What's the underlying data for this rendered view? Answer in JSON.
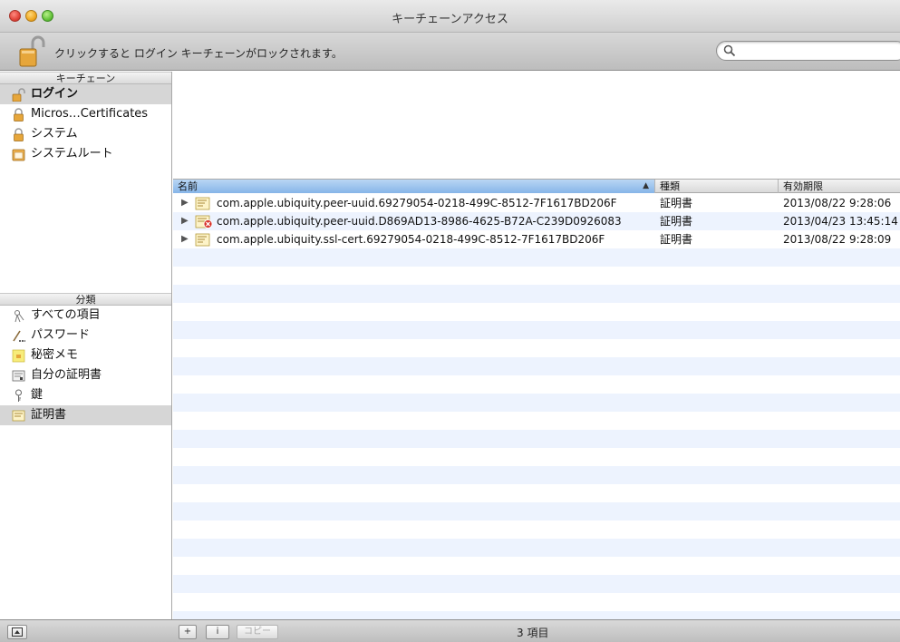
{
  "window": {
    "title": "キーチェーンアクセス"
  },
  "toolbar": {
    "lock_message": "クリックすると ログイン キーチェーンがロックされます。",
    "search_placeholder": ""
  },
  "sidebar": {
    "keychains_header": "キーチェーン",
    "keychains": [
      {
        "label": "ログイン",
        "icon": "unlocked-padlock-icon",
        "selected": true
      },
      {
        "label": "Micros…Certificates",
        "icon": "padlock-icon"
      },
      {
        "label": "システム",
        "icon": "padlock-icon"
      },
      {
        "label": "システムルート",
        "icon": "cabinet-icon"
      }
    ],
    "category_header": "分類",
    "categories": [
      {
        "label": "すべての項目",
        "icon": "all-items-icon"
      },
      {
        "label": "パスワード",
        "icon": "password-icon"
      },
      {
        "label": "秘密メモ",
        "icon": "secure-note-icon"
      },
      {
        "label": "自分の証明書",
        "icon": "my-certificate-icon"
      },
      {
        "label": "鍵",
        "icon": "key-icon"
      },
      {
        "label": "証明書",
        "icon": "certificate-icon",
        "selected": true
      }
    ]
  },
  "table": {
    "columns": {
      "name": "名前",
      "kind": "種類",
      "expiry": "有効期限"
    },
    "sort_indicator": "▲",
    "rows": [
      {
        "name": "com.apple.ubiquity.peer-uuid.69279054-0218-499C-8512-7F1617BD206F",
        "kind": "証明書",
        "expiry": "2013/08/22 9:28:06",
        "invalid": false
      },
      {
        "name": "com.apple.ubiquity.peer-uuid.D869AD13-8986-4625-B72A-C239D0926083",
        "kind": "証明書",
        "expiry": "2013/04/23 13:45:14",
        "invalid": true
      },
      {
        "name": "com.apple.ubiquity.ssl-cert.69279054-0218-499C-8512-7F1617BD206F",
        "kind": "証明書",
        "expiry": "2013/08/22 9:28:09",
        "invalid": false
      }
    ]
  },
  "bottombar": {
    "add_label": "+",
    "info_label": "i",
    "copy_label": "コピー",
    "item_count": "3 項目"
  },
  "colors": {
    "selection": "#d6d6d6",
    "column_sorted": "#86b5e8",
    "row_alt": "#edf3fe"
  }
}
